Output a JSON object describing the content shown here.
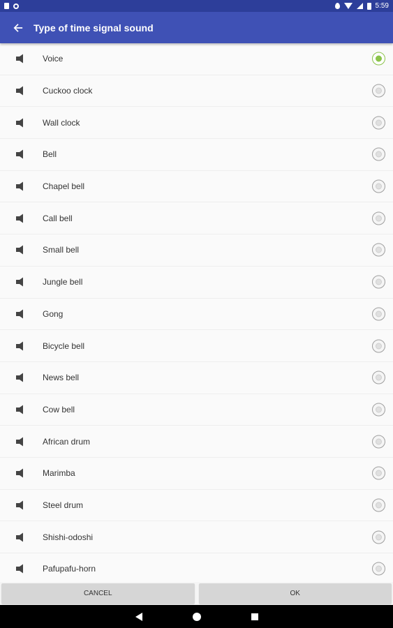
{
  "status_bar": {
    "time": "5:59"
  },
  "app_bar": {
    "title": "Type of time signal sound"
  },
  "items": [
    {
      "label": "Voice",
      "selected": true
    },
    {
      "label": "Cuckoo clock",
      "selected": false
    },
    {
      "label": "Wall clock",
      "selected": false
    },
    {
      "label": "Bell",
      "selected": false
    },
    {
      "label": "Chapel bell",
      "selected": false
    },
    {
      "label": "Call bell",
      "selected": false
    },
    {
      "label": "Small bell",
      "selected": false
    },
    {
      "label": "Jungle bell",
      "selected": false
    },
    {
      "label": "Gong",
      "selected": false
    },
    {
      "label": "Bicycle bell",
      "selected": false
    },
    {
      "label": "News bell",
      "selected": false
    },
    {
      "label": "Cow bell",
      "selected": false
    },
    {
      "label": "African drum",
      "selected": false
    },
    {
      "label": "Marimba",
      "selected": false
    },
    {
      "label": "Steel drum",
      "selected": false
    },
    {
      "label": "Shishi-odoshi",
      "selected": false
    },
    {
      "label": "Pafupafu-horn",
      "selected": false
    }
  ],
  "buttons": {
    "cancel": "CANCEL",
    "ok": "OK"
  },
  "colors": {
    "primary": "#3f51b5",
    "status_bar": "#2d3e9a",
    "accent": "#8bc34a"
  }
}
